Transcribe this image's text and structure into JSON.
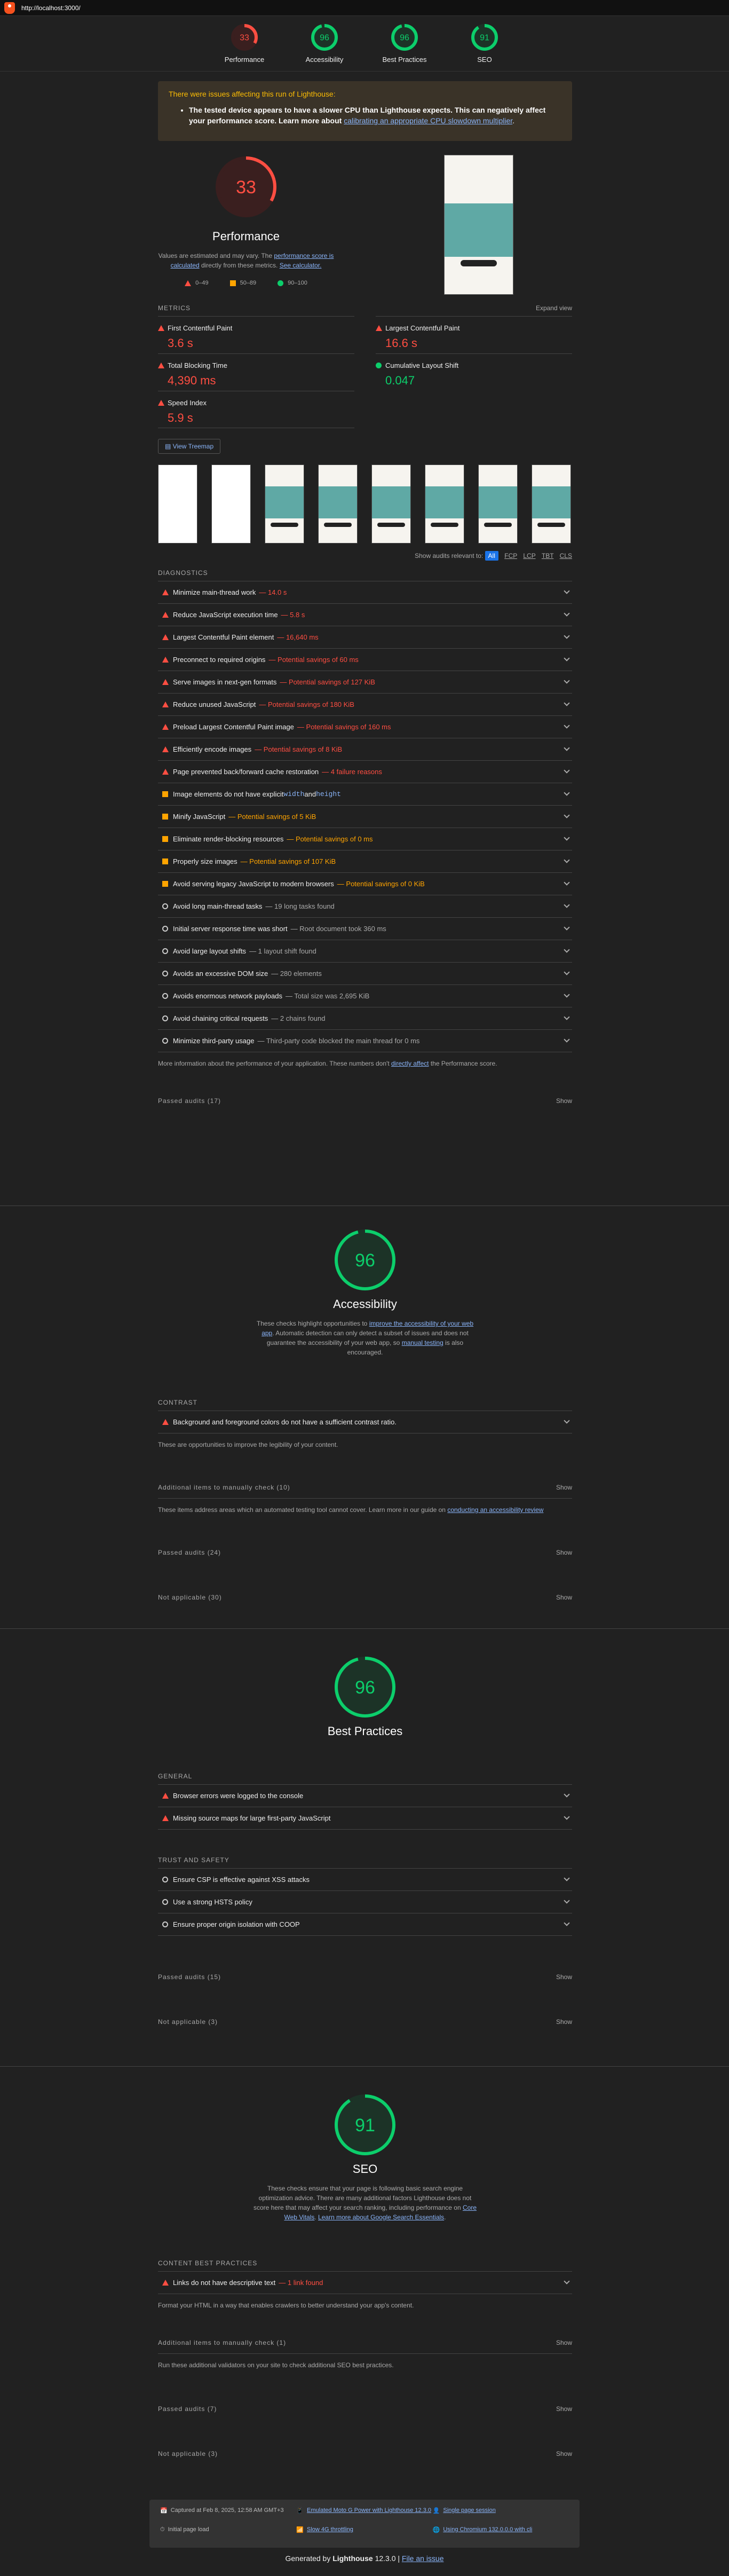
{
  "browser": {
    "url": "http://localhost:3000/"
  },
  "nav_gauges": [
    {
      "label": "Performance",
      "score": "33",
      "color": "#ff4e42"
    },
    {
      "label": "Accessibility",
      "score": "96",
      "color": "#0cce6b"
    },
    {
      "label": "Best Practices",
      "score": "96",
      "color": "#0cce6b"
    },
    {
      "label": "SEO",
      "score": "91",
      "color": "#0cce6b"
    }
  ],
  "warning": {
    "title": "There were issues affecting this run of Lighthouse:",
    "item_bold": "The tested device appears to have a slower CPU than Lighthouse expects. This can negatively affect your performance score. Learn more about",
    "item_link": "calibrating an appropriate CPU slowdown multiplier",
    "item_end": "."
  },
  "performance": {
    "score": "33",
    "title": "Performance",
    "desc1": "Values are estimated and may vary. The",
    "desc_link1": "performance score is calculated",
    "desc2": "directly from these metrics.",
    "desc_link2": "See calculator.",
    "legend": [
      "0–49",
      "50–89",
      "90–100"
    ],
    "metrics_header": "Metrics",
    "expand": "Expand view",
    "metrics": [
      {
        "name": "First Contentful Paint",
        "value": "3.6 s"
      },
      {
        "name": "Largest Contentful Paint",
        "value": "16.6 s"
      },
      {
        "name": "Total Blocking Time",
        "value": "4,390 ms"
      },
      {
        "name": "Cumulative Layout Shift",
        "value": "0.047"
      },
      {
        "name": "Speed Index",
        "value": "5.9 s"
      }
    ],
    "treemap": "View Treemap",
    "relevant": "Show audits relevant to:",
    "filters": [
      "All",
      "FCP",
      "LCP",
      "TBT",
      "CLS"
    ],
    "diagnostics_header": "Diagnostics",
    "audits": [
      {
        "title": "Minimize main-thread work",
        "disp": "— 14.0 s",
        "level": "fail"
      },
      {
        "title": "Reduce JavaScript execution time",
        "disp": "— 5.8 s",
        "level": "fail"
      },
      {
        "title": "Largest Contentful Paint element",
        "disp": "— 16,640 ms",
        "level": "fail"
      },
      {
        "title": "Preconnect to required origins",
        "disp": "— Potential savings of 60 ms",
        "level": "fail"
      },
      {
        "title": "Serve images in next-gen formats",
        "disp": "— Potential savings of 127 KiB",
        "level": "fail"
      },
      {
        "title": "Reduce unused JavaScript",
        "disp": "— Potential savings of 180 KiB",
        "level": "fail"
      },
      {
        "title": "Preload Largest Contentful Paint image",
        "disp": "— Potential savings of 160 ms",
        "level": "fail"
      },
      {
        "title": "Efficiently encode images",
        "disp": "— Potential savings of 8 KiB",
        "level": "fail"
      },
      {
        "title": "Page prevented back/forward cache restoration",
        "disp": "— 4 failure reasons",
        "level": "fail"
      },
      {
        "title": "Image elements do not have explicit",
        "disp": "",
        "level": "average"
      },
      {
        "title": "Minify JavaScript",
        "disp": "— Potential savings of 5 KiB",
        "level": "average"
      },
      {
        "title": "Eliminate render-blocking resources",
        "disp": "— Potential savings of 0 ms",
        "level": "average"
      },
      {
        "title": "Properly size images",
        "disp": "— Potential savings of 107 KiB",
        "level": "average"
      },
      {
        "title": "Avoid serving legacy JavaScript to modern browsers",
        "disp": "— Potential savings of 0 KiB",
        "level": "average"
      },
      {
        "title": "Avoid long main-thread tasks",
        "disp": "— 19 long tasks found",
        "level": "info"
      },
      {
        "title": "Initial server response time was short",
        "disp": "— Root document took 360 ms",
        "level": "info"
      },
      {
        "title": "Avoid large layout shifts",
        "disp": "— 1 layout shift found",
        "level": "info"
      },
      {
        "title": "Avoids an excessive DOM size",
        "disp": "— 280 elements",
        "level": "info"
      },
      {
        "title": "Avoids enormous network payloads",
        "disp": "— Total size was 2,695 KiB",
        "level": "info"
      },
      {
        "title": "Avoid chaining critical requests",
        "disp": "— 2 chains found",
        "level": "info"
      },
      {
        "title": "Minimize third-party usage",
        "disp": "— Third-party code blocked the main thread for 0 ms",
        "level": "info"
      }
    ],
    "img_width_code": "width",
    "img_and": "and",
    "img_height_code": "height",
    "footnote": "More information about the performance of your application. These numbers don't",
    "footnote_link": "directly affect",
    "footnote_end": "the Performance score.",
    "passed": "Passed audits (17)",
    "show": "Show"
  },
  "accessibility": {
    "score": "96",
    "title": "Accessibility",
    "desc1": "These checks highlight opportunities to",
    "link1": "improve the accessibility of your web app",
    "desc2": ". Automatic detection can only detect a subset of issues and does not guarantee the accessibility of your web app, so",
    "link2": "manual testing",
    "desc3": "is also encouraged.",
    "contrast_header": "Contrast",
    "contrast_audit": "Background and foreground colors do not have a sufficient contrast ratio.",
    "contrast_note": "These are opportunities to improve the legibility of your content.",
    "manual": "Additional items to manually check (10)",
    "manual_note": "These items address areas which an automated testing tool cannot cover. Learn more in our guide on",
    "manual_link": "conducting an accessibility review",
    "passed": "Passed audits (24)",
    "na": "Not applicable (30)",
    "show": "Show"
  },
  "best_practices": {
    "score": "96",
    "title": "Best Practices",
    "general_header": "General",
    "general": [
      "Browser errors were logged to the console",
      "Missing source maps for large first-party JavaScript"
    ],
    "trust_header": "Trust and Safety",
    "trust": [
      "Ensure CSP is effective against XSS attacks",
      "Use a strong HSTS policy",
      "Ensure proper origin isolation with COOP"
    ],
    "passed": "Passed audits (15)",
    "na": "Not applicable (3)",
    "show": "Show"
  },
  "seo": {
    "score": "91",
    "title": "SEO",
    "desc1": "These checks ensure that your page is following basic search engine optimization advice. There are many additional factors Lighthouse does not score here that may affect your search ranking, including performance on",
    "link1": "Core Web Vitals",
    "link2": "Learn more about Google Search Essentials",
    "content_header": "Content Best Practices",
    "content_audit": "Links do not have descriptive text",
    "content_disp": "— 1 link found",
    "content_note": "Format your HTML in a way that enables crawlers to better understand your app's content.",
    "manual": "Additional items to manually check (1)",
    "manual_note": "Run these additional validators on your site to check additional SEO best practices.",
    "passed": "Passed audits (7)",
    "na": "Not applicable (3)",
    "show": "Show"
  },
  "footer": {
    "captured": "Captured at Feb 8, 2025, 12:58 AM GMT+3",
    "device": "Emulated Moto G Power with Lighthouse 12.3.0",
    "session": "Single page session",
    "load": "Initial page load",
    "throttle": "Slow 4G throttling",
    "chromium": "Using Chromium 132.0.0.0 with cli",
    "generated": "Generated by",
    "tool": "Lighthouse",
    "version": "12.3.0 |",
    "issue": "File an issue"
  }
}
